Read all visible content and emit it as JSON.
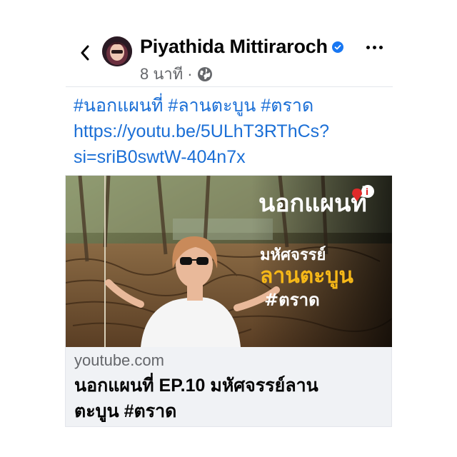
{
  "post": {
    "author": "Piyathida Mittiraroch",
    "time": "8 นาที",
    "separator": "·",
    "text_lines": [
      "#นอกแผนที่ #ลานตะบูน #ตราด",
      "https://youtu.be/5ULhT3RThCs?",
      "si=sriB0swtW-404n7x"
    ]
  },
  "link_card": {
    "thumbnail": {
      "logo_text": "นอกแผนที่",
      "overlay_line1": "มหัศจรรย์",
      "overlay_line2": "ลานตะบูน",
      "overlay_line3": "#ตราด"
    },
    "domain": "youtube.com",
    "title_line1": "นอกแผนที่ EP.10 มหัศจรรย์ลาน",
    "title_line2": "ตะบูน #ตราด"
  },
  "icons": {
    "back": "chevron-left-icon",
    "verified": "verified-badge-icon",
    "audience": "globe-icon",
    "more": "more-horizontal-icon"
  },
  "colors": {
    "link": "#1b6fd6",
    "verified": "#1877f2",
    "meta": "#65676b",
    "overlay_accent": "#f6b818"
  }
}
